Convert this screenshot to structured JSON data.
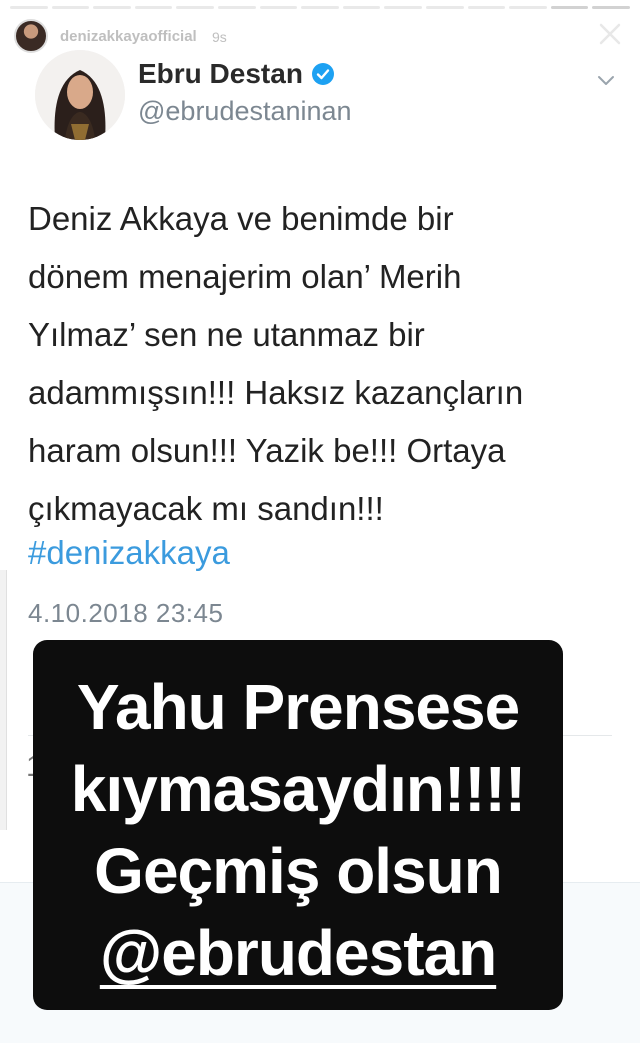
{
  "story": {
    "username": "denizakkayaofficial",
    "time": "9s"
  },
  "tweet": {
    "name": "Ebru Destan",
    "handle": "@ebrudestaninan",
    "lines": [
      "Deniz Akkaya ve benimde bir",
      "dönem menajerim olan’ Merih",
      "Yılmaz’ sen ne utanmaz bir",
      "adammışsın!!! Haksız kazançların",
      "haram olsun!!! Yazik be!!! Ortaya",
      "çıkmayacak mı sandın!!!"
    ],
    "hashtag": "#denizakkaya",
    "date": "4.10.2018 23:45"
  },
  "caption": {
    "line1": "Yahu Prensese",
    "line2": "kıymasaydın!!!!",
    "line3": "Geçmiş  olsun",
    "line4": "@ebrudestan"
  },
  "colors": {
    "link": "#3b9bde",
    "verified": "#1da1f2",
    "caption_bg": "#0d0d0d"
  },
  "icons": [
    "close-icon",
    "verified-badge-icon",
    "chevron-down-icon"
  ]
}
